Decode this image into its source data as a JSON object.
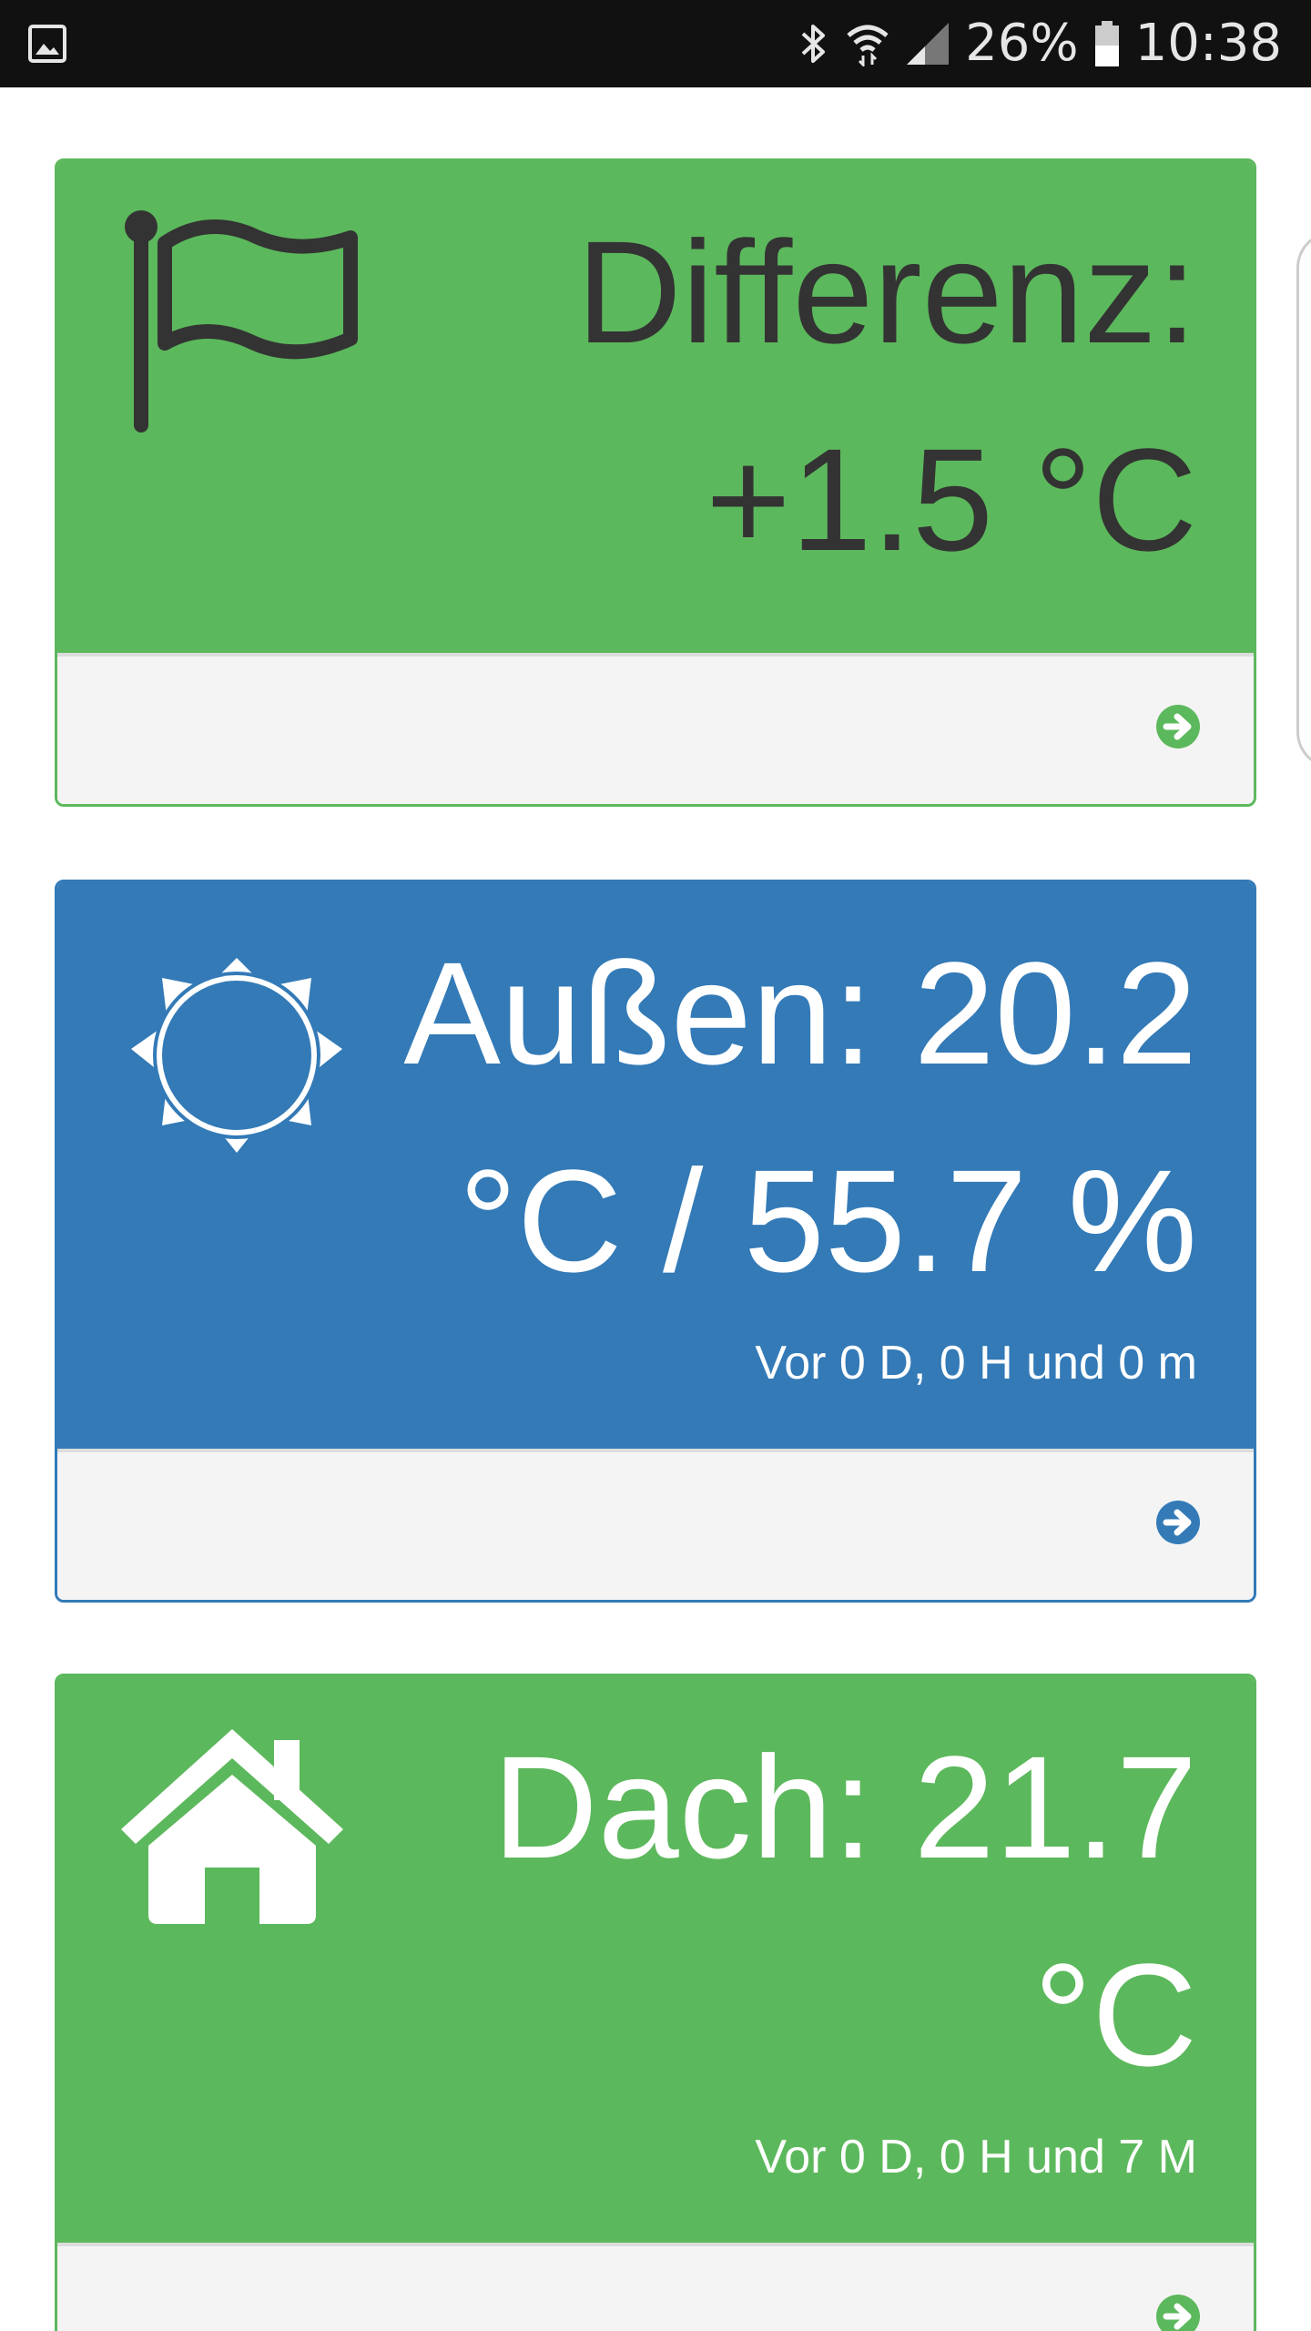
{
  "status_bar": {
    "battery_percent": "26%",
    "time": "10:38",
    "icons": [
      "gallery-icon",
      "bluetooth-icon",
      "wifi-icon",
      "signal-icon",
      "battery-icon"
    ]
  },
  "panels": [
    {
      "color": "#5cb85c",
      "icon": "flag-icon",
      "line1": "Differenz:",
      "line2": "+1.5 °C",
      "footer_icon": "arrow-circle-right-icon"
    },
    {
      "color": "#337ab7",
      "icon": "sun-icon",
      "line1": "Außen: 20.2",
      "line2": "°C / 55.7 %",
      "subtitle": "Vor 0 D, 0 H und 0 m",
      "footer_icon": "arrow-circle-right-icon"
    },
    {
      "color": "#5cb85c",
      "icon": "home-icon",
      "line1": "Dach: 21.7",
      "line2": "°C",
      "subtitle": "Vor 0 D, 0 H und 7 M",
      "footer_icon": "arrow-circle-right-icon"
    }
  ]
}
